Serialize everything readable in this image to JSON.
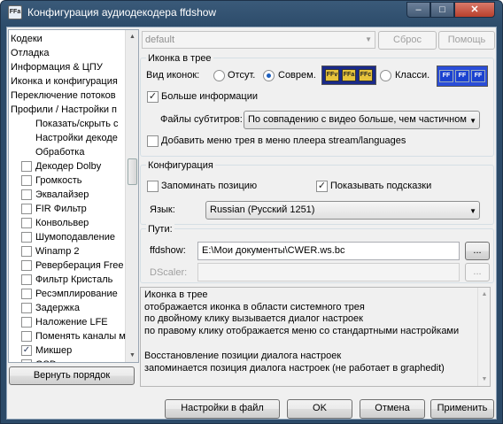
{
  "window": {
    "title": "Конфигурация аудиодекодера ffdshow",
    "app_icon": "FFa",
    "minimize_glyph": "‒",
    "maximize_glyph": "□",
    "close_glyph": "✕"
  },
  "tree": {
    "items": [
      {
        "label": "Кодеки",
        "indent": 0,
        "check": null
      },
      {
        "label": "Отладка",
        "indent": 0,
        "check": null
      },
      {
        "label": "Информация & ЦПУ",
        "indent": 0,
        "check": null
      },
      {
        "label": "Иконка и конфигурация",
        "indent": 0,
        "check": null
      },
      {
        "label": "Переключение потоков",
        "indent": 0,
        "check": null
      },
      {
        "label": "Профили / Настройки п",
        "indent": 0,
        "check": null
      },
      {
        "label": "Показать/скрыть с",
        "indent": 1,
        "check": null
      },
      {
        "label": "Настройки декоде",
        "indent": 1,
        "check": null
      },
      {
        "label": "Обработка",
        "indent": 1,
        "check": null
      },
      {
        "label": "Декодер Dolby",
        "indent": 1,
        "check": false
      },
      {
        "label": "Громкость",
        "indent": 1,
        "check": false
      },
      {
        "label": "Эквалайзер",
        "indent": 1,
        "check": false
      },
      {
        "label": "FIR Фильтр",
        "indent": 1,
        "check": false
      },
      {
        "label": "Конвольвер",
        "indent": 1,
        "check": false
      },
      {
        "label": "Шумоподавление",
        "indent": 1,
        "check": false
      },
      {
        "label": "Winamp 2",
        "indent": 1,
        "check": false
      },
      {
        "label": "Реверберация Free",
        "indent": 1,
        "check": false
      },
      {
        "label": "Фильтр Кристаль",
        "indent": 1,
        "check": false
      },
      {
        "label": "Ресэмплирование",
        "indent": 1,
        "check": false
      },
      {
        "label": "Задержка",
        "indent": 1,
        "check": false
      },
      {
        "label": "Наложение LFE",
        "indent": 1,
        "check": false
      },
      {
        "label": "Поменять каналы м",
        "indent": 1,
        "check": false
      },
      {
        "label": "Микшер",
        "indent": 1,
        "check": true
      },
      {
        "label": "OSD",
        "indent": 1,
        "check": false
      }
    ],
    "reorder_button": "Вернуть порядок"
  },
  "preset": {
    "value": "default",
    "reset_button": "Сброс",
    "help_button": "Помощь"
  },
  "tray_group": {
    "title": "Иконка в трее",
    "icon_view_label": "Вид иконок:",
    "radio_none": "Отсут.",
    "radio_modern": "Соврем.",
    "radio_classic": "Класси.",
    "selected": "modern",
    "modern_icons": [
      "FFv",
      "FFa",
      "FFc"
    ],
    "classic_icons": [
      "FF",
      "FF",
      "FF"
    ],
    "more_info_label": "Больше информации",
    "more_info_checked": true,
    "subtitles_label": "Файлы субтитров:",
    "subtitles_value": "По совпадению с видео больше, чем частичном",
    "add_menu_label": "Добавить меню трея в меню плеера stream/languages",
    "add_menu_checked": false
  },
  "config_group": {
    "title": "Конфигурация",
    "remember_pos_label": "Запоминать позицию",
    "remember_pos_checked": false,
    "show_tips_label": "Показывать подсказки",
    "show_tips_checked": true,
    "language_label": "Язык:",
    "language_value": "Russian (Русский 1251)"
  },
  "paths_group": {
    "title": "Пути:",
    "ffdshow_label": "ffdshow:",
    "ffdshow_value": "E:\\Мои документы\\CWER.ws.bc",
    "dscaler_label": "DScaler:",
    "dscaler_value": "",
    "browse_label": "..."
  },
  "help_text": {
    "lines": [
      "Иконка в трее",
      "  отображается иконка в области системного трея",
      "  по двойному клику вызывается диалог настроек",
      "  по правому клику отображается меню со стандартными настройками",
      "",
      "Восстановление позиции диалога настроек",
      "  запоминается позиция диалога настроек (не работает в graphedit)"
    ]
  },
  "footer": {
    "save_button": "Настройки в файл",
    "ok_button": "OK",
    "cancel_button": "Отмена",
    "apply_button": "Применить"
  },
  "colors": {
    "accent": "#1d5fbf",
    "titlebar": "#2c4b6a",
    "close": "#c7503c"
  }
}
